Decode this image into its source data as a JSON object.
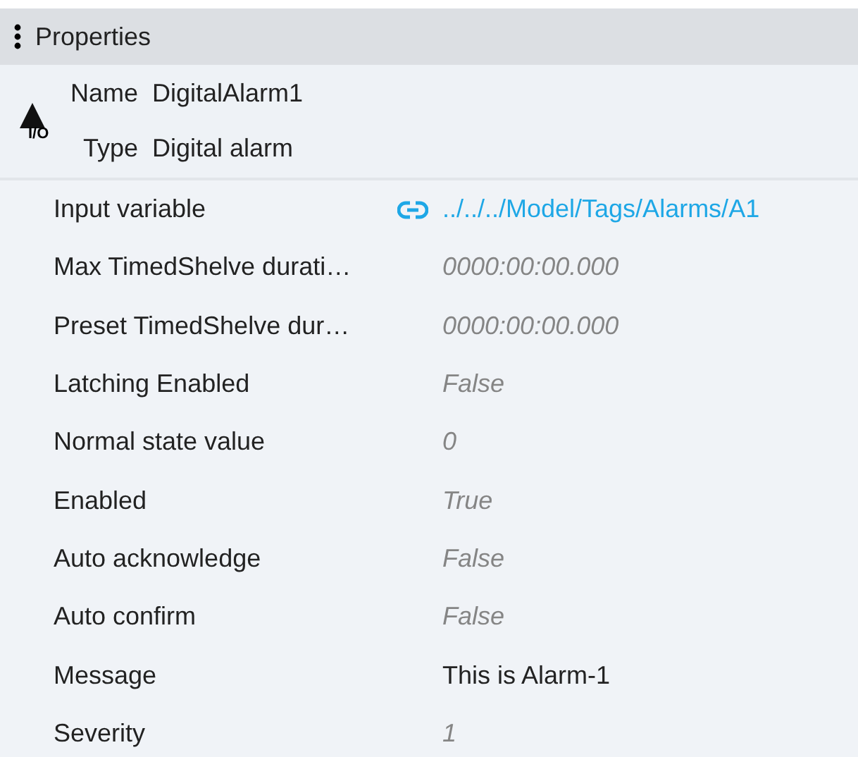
{
  "panel": {
    "title": "Properties"
  },
  "info": [
    {
      "label": "Name",
      "value": "DigitalAlarm1"
    },
    {
      "label": "Type",
      "value": "Digital alarm"
    }
  ],
  "icon_text": "I/O",
  "properties": [
    {
      "label": "Input variable",
      "value": "../../../Model/Tags/Alarms/A1",
      "kind": "link"
    },
    {
      "label": "Max TimedShelve durati…",
      "value": "0000:00:00.000",
      "kind": "default"
    },
    {
      "label": "Preset TimedShelve dur…",
      "value": "0000:00:00.000",
      "kind": "default"
    },
    {
      "label": "Latching Enabled",
      "value": "False",
      "kind": "default"
    },
    {
      "label": "Normal state value",
      "value": "0",
      "kind": "default"
    },
    {
      "label": "Enabled",
      "value": "True",
      "kind": "default"
    },
    {
      "label": "Auto acknowledge",
      "value": "False",
      "kind": "default"
    },
    {
      "label": "Auto confirm",
      "value": "False",
      "kind": "default"
    },
    {
      "label": "Message",
      "value": "This is Alarm-1",
      "kind": "set"
    },
    {
      "label": "Severity",
      "value": "1",
      "kind": "default"
    }
  ]
}
